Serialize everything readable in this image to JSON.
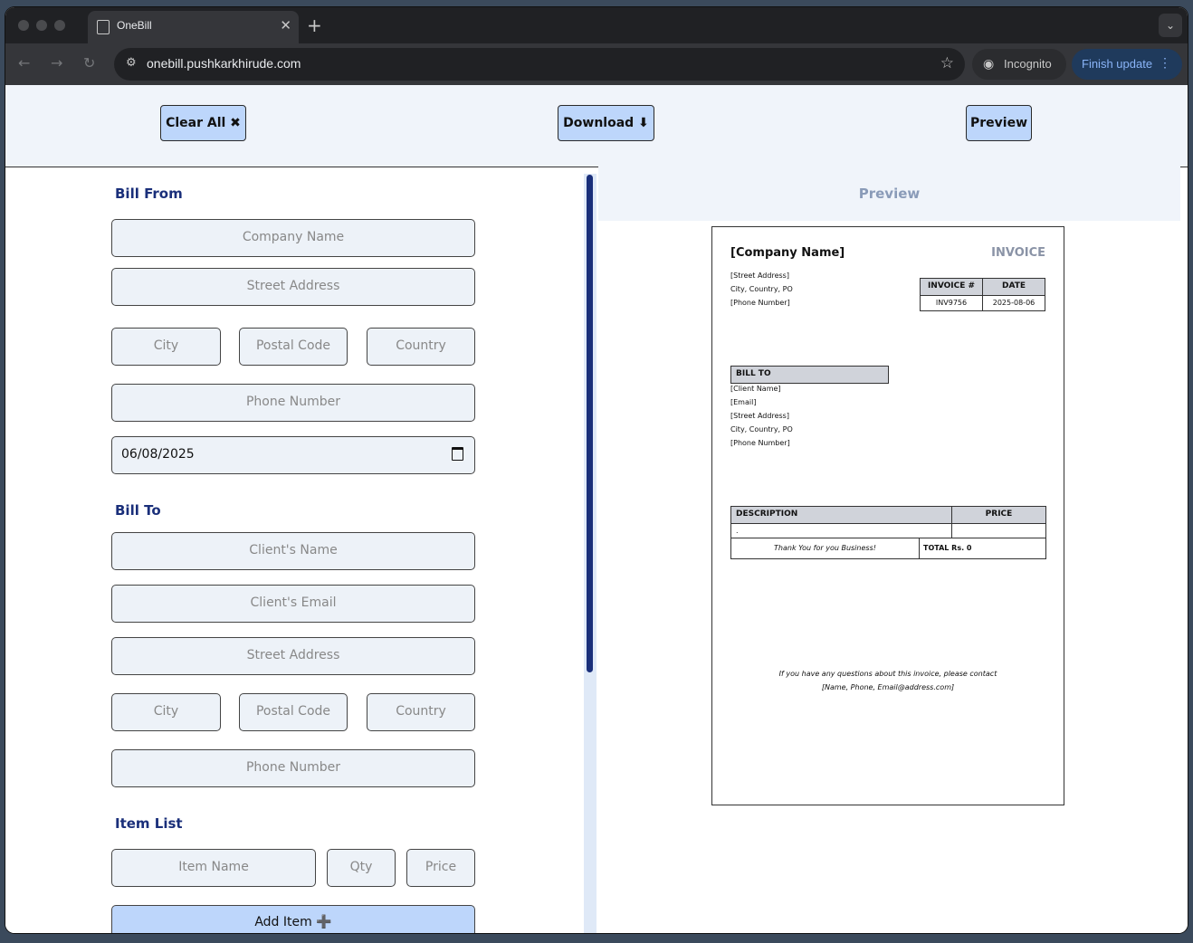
{
  "browser": {
    "tab_title": "OneBill",
    "url": "onebill.pushkarkhirude.com",
    "incognito_label": "Incognito",
    "update_label": "Finish update"
  },
  "toolbar": {
    "clear_label": "Clear All ✖",
    "download_label": "Download ⬇",
    "preview_label": "Preview"
  },
  "form": {
    "bill_from": {
      "title": "Bill From",
      "company_placeholder": "Company Name",
      "street_placeholder": "Street Address",
      "city_placeholder": "City",
      "postal_placeholder": "Postal Code",
      "country_placeholder": "Country",
      "phone_placeholder": "Phone Number",
      "date_value": "06/08/2025"
    },
    "bill_to": {
      "title": "Bill To",
      "name_placeholder": "Client's Name",
      "email_placeholder": "Client's Email",
      "street_placeholder": "Street Address",
      "city_placeholder": "City",
      "postal_placeholder": "Postal Code",
      "country_placeholder": "Country",
      "phone_placeholder": "Phone Number"
    },
    "items": {
      "title": "Item List",
      "name_placeholder": "Item Name",
      "qty_placeholder": "Qty",
      "price_placeholder": "Price",
      "add_label": "Add Item ➕"
    }
  },
  "preview": {
    "heading": "Preview",
    "invoice": {
      "company": "[Company Name]",
      "title": "INVOICE",
      "street": "[Street Address]",
      "city_line": "City, Country, PO",
      "phone": "[Phone Number]",
      "invoice_no_label": "INVOICE #",
      "date_label": "DATE",
      "invoice_no": "INV9756",
      "date": "2025-08-06",
      "bill_to_label": "BILL TO",
      "client_name": "[Client Name]",
      "client_email": "[Email]",
      "client_street": "[Street Address]",
      "client_city_line": "City, Country, PO",
      "client_phone": "[Phone Number]",
      "desc_label": "DESCRIPTION",
      "price_label": "PRICE",
      "row_desc": ".",
      "thanks": "Thank You for you Business!",
      "total": "TOTAL Rs. 0",
      "footer_line1": "If you have any questions about this invoice, please contact",
      "footer_line2": "[Name, Phone, Email@address.com]"
    }
  }
}
